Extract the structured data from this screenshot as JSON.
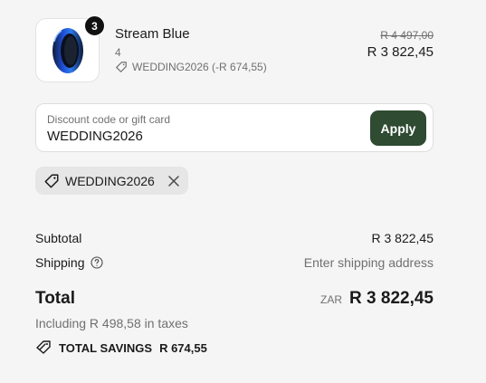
{
  "line_item": {
    "quantity": "3",
    "name": "Stream Blue",
    "variant": "4",
    "discount": "WEDDING2026 (-R 674,55)",
    "original_price": "R 4 497,00",
    "price": "R 3 822,45",
    "thumbnail_icon": "ring-product-image"
  },
  "discount_form": {
    "placeholder": "Discount code or gift card",
    "value": "WEDDING2026",
    "apply_label": "Apply"
  },
  "applied_code": {
    "code": "WEDDING2026",
    "tag_icon": "tag-icon",
    "remove_icon": "close-icon"
  },
  "summary": {
    "subtotal_label": "Subtotal",
    "subtotal_value": "R 3 822,45",
    "shipping_label": "Shipping",
    "shipping_value": "Enter shipping address",
    "total_label": "Total",
    "currency": "ZAR",
    "total_value": "R 3 822,45",
    "taxes_note": "Including R 498,58 in taxes",
    "savings_label": "TOTAL SAVINGS",
    "savings_value": "R 674,55"
  },
  "colors": {
    "background": "#f5f5f5",
    "accent": "#2f4b32",
    "muted_text": "#707070"
  }
}
